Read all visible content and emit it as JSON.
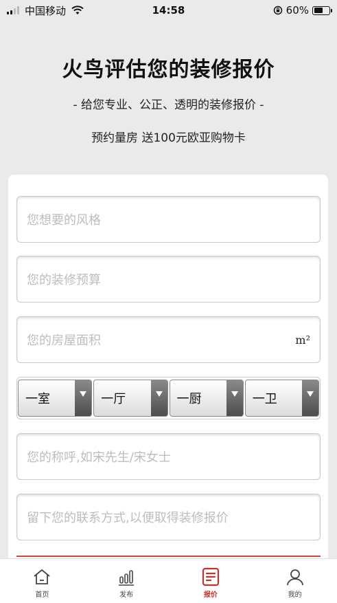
{
  "status_bar": {
    "carrier": "中国移动",
    "time": "14:58",
    "battery": "60%",
    "battery_level": 0.6
  },
  "header": {
    "title": "火鸟评估您的装修报价",
    "subtitle": "- 给您专业、公正、透明的装修报价 -",
    "promo": "预约量房 送100元欧亚购物卡"
  },
  "form": {
    "style_placeholder": "您想要的风格",
    "budget_placeholder": "您的装修预算",
    "area_placeholder": "您的房屋面积",
    "area_unit": "m²",
    "selects": {
      "rooms": "一室",
      "halls": "一厅",
      "kitchens": "一厨",
      "baths": "一卫"
    },
    "name_placeholder": "您的称呼,如宋先生/宋女士",
    "contact_placeholder": "留下您的联系方式,以便取得装修报价"
  },
  "tabs": [
    {
      "label": "首页",
      "icon": "home-icon"
    },
    {
      "label": "发布",
      "icon": "bar-chart-icon"
    },
    {
      "label": "报价",
      "icon": "quote-document-icon"
    },
    {
      "label": "我的",
      "icon": "user-icon"
    }
  ],
  "colors": {
    "accent": "#c9302c",
    "background": "#eaeaea"
  }
}
